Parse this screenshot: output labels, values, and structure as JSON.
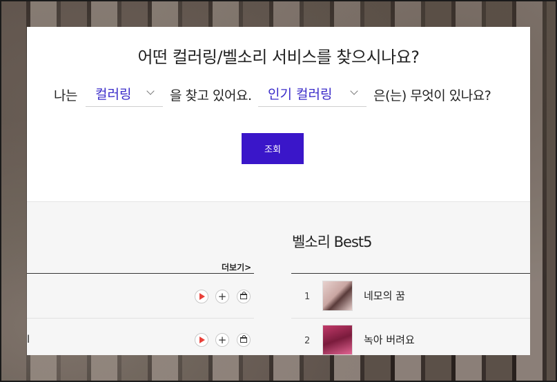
{
  "finder": {
    "title": "어떤 컬러링/벨소리 서비스를 찾으시나요?",
    "prefix": "나는",
    "select1_value": "컬러링",
    "middle": "을 찾고 있어요.",
    "select2_value": "인기 컬러링",
    "suffix": "은(는) 무엇이 있나요?",
    "search_label": "조회"
  },
  "left_list": {
    "more_label": "더보기>",
    "partial_text": "l"
  },
  "best5": {
    "title": "벨소리 Best5",
    "items": [
      {
        "rank": "1",
        "title": "네모의 꿈"
      },
      {
        "rank": "2",
        "title": "녹아 버려요"
      }
    ]
  }
}
